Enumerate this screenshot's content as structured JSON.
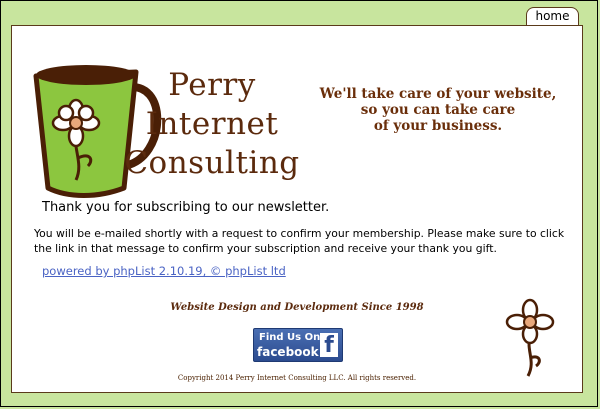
{
  "nav": {
    "home_label": "home"
  },
  "brand": {
    "line1": "Perry",
    "line2": "Internet",
    "line3": "Consulting"
  },
  "tagline": {
    "line1": "We'll take care of your website,",
    "line2": "so you can take care",
    "line3": "of your business."
  },
  "content": {
    "thanks": "Thank you for subscribing to our newsletter.",
    "message": "You will be e-mailed shortly with a request to confirm your membership. Please make sure to click the link in that message to confirm your subscription and receive your thank you gift.",
    "powered_by": "powered by phpList 2.10.19, © phpList ltd"
  },
  "footer": {
    "since": "Website Design and Development Since 1998",
    "facebook_line1": "Find Us On",
    "facebook_line2": "facebook",
    "facebook_f": "f",
    "copyright": "Copyright 2014 Perry Internet Consulting LLC.  All rights reserved."
  },
  "colors": {
    "background": "#c8e59e",
    "brand_brown": "#5b2a0d",
    "mug_green": "#8cc63f",
    "link_blue": "#4a63c4",
    "facebook_blue": "#3b5998"
  }
}
